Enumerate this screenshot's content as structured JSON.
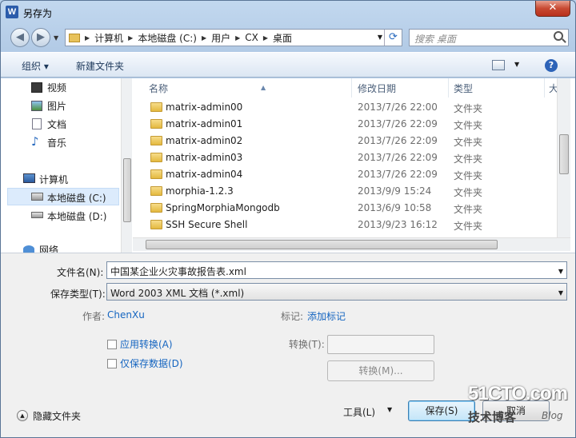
{
  "window": {
    "title": "另存为",
    "app_icon_letter": "W",
    "close_glyph": "✕"
  },
  "nav": {
    "back_glyph": "◀",
    "forward_glyph": "▶",
    "breadcrumbs": [
      "计算机",
      "本地磁盘 (C:)",
      "用户",
      "CX",
      "桌面"
    ],
    "search_placeholder": "搜索 桌面"
  },
  "toolbar": {
    "organize": "组织 ▾",
    "new_folder": "新建文件夹",
    "help": "?"
  },
  "sidebar": {
    "items": [
      {
        "label": "视频",
        "icon": "video-icon"
      },
      {
        "label": "图片",
        "icon": "pictures-icon"
      },
      {
        "label": "文档",
        "icon": "documents-icon"
      },
      {
        "label": "音乐",
        "icon": "music-icon"
      },
      {
        "label": "计算机",
        "icon": "computer-icon"
      },
      {
        "label": "本地磁盘 (C:)",
        "icon": "drive-c-icon",
        "selected": true
      },
      {
        "label": "本地磁盘 (D:)",
        "icon": "drive-d-icon"
      },
      {
        "label": "网络",
        "icon": "network-icon"
      }
    ]
  },
  "columns": {
    "name": "名称",
    "date": "修改日期",
    "type": "类型",
    "size": "大"
  },
  "files": [
    {
      "name": "matrix-admin00",
      "date": "2013/7/26 22:00",
      "type": "文件夹"
    },
    {
      "name": "matrix-admin01",
      "date": "2013/7/26 22:09",
      "type": "文件夹"
    },
    {
      "name": "matrix-admin02",
      "date": "2013/7/26 22:09",
      "type": "文件夹"
    },
    {
      "name": "matrix-admin03",
      "date": "2013/7/26 22:09",
      "type": "文件夹"
    },
    {
      "name": "matrix-admin04",
      "date": "2013/7/26 22:09",
      "type": "文件夹"
    },
    {
      "name": "morphia-1.2.3",
      "date": "2013/9/9 15:24",
      "type": "文件夹"
    },
    {
      "name": "SpringMorphiaMongodb",
      "date": "2013/6/9 10:58",
      "type": "文件夹"
    },
    {
      "name": "SSH Secure Shell",
      "date": "2013/9/23 16:12",
      "type": "文件夹"
    }
  ],
  "form": {
    "filename_label": "文件名(N):",
    "filename_value": "中国某企业火灾事故报告表.xml",
    "filetype_label": "保存类型(T):",
    "filetype_value": "Word 2003 XML 文档 (*.xml)",
    "author_label": "作者:",
    "author_value": "ChenXu",
    "tags_label": "标记:",
    "tags_value": "添加标记",
    "apply_transform": "应用转换(A)",
    "data_only": "仅保存数据(D)",
    "transform_label": "转换(T):",
    "transform_button": "转换(M)...",
    "hide_folders": "隐藏文件夹",
    "tools": "工具(L)",
    "save": "保存(S)",
    "cancel": "取消"
  },
  "watermark": {
    "line1": "51CTO.com",
    "line2": "技术博客",
    "line3": "Blog"
  }
}
